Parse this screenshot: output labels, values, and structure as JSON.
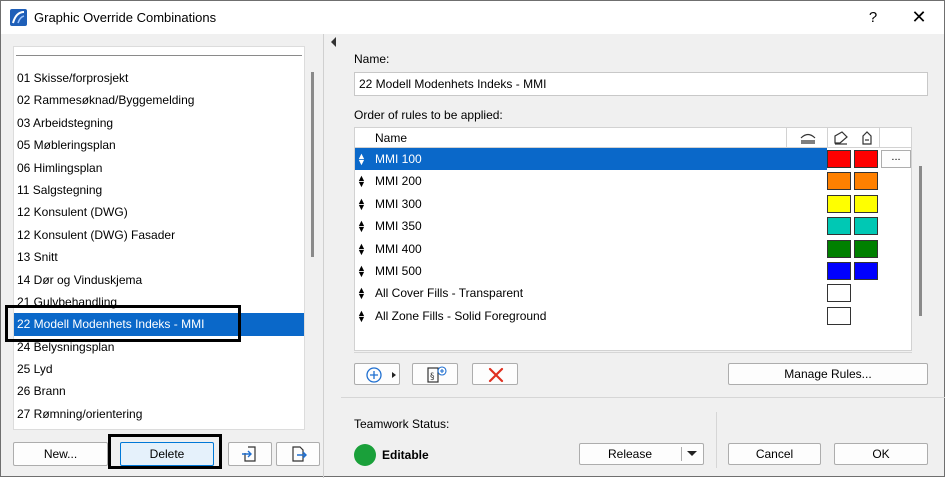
{
  "window": {
    "title": "Graphic Override Combinations",
    "help": "?",
    "close": "✕"
  },
  "combinations": {
    "items": [
      "01 Skisse/forprosjekt",
      "02 Rammesøknad/Byggemelding",
      "03 Arbeidstegning",
      "05 Møbleringsplan",
      "06 Himlingsplan",
      "11 Salgstegning",
      "12 Konsulent (DWG)",
      "12 Konsulent (DWG) Fasader",
      "13 Snitt",
      "14 Dør og Vinduskjema",
      "21 Gulvbehandling",
      "22 Modell Modenhets Indeks - MMI",
      "24 Belysningsplan",
      "25 Lyd",
      "26 Brann",
      "27 Rømning/orientering"
    ],
    "selected_index": 11
  },
  "left_buttons": {
    "new": "New...",
    "delete": "Delete"
  },
  "form": {
    "name_label": "Name:",
    "name_value": "22 Modell Modenhets Indeks - MMI",
    "rules_label": "Order of rules to be applied:"
  },
  "rules": {
    "header_name": "Name",
    "rows": [
      {
        "name": "MMI 100",
        "fill": "#ff0000",
        "line": "#ff0000",
        "selected": true
      },
      {
        "name": "MMI 200",
        "fill": "#ff8000",
        "line": "#ff8000",
        "selected": false
      },
      {
        "name": "MMI 300",
        "fill": "#ffff00",
        "line": "#ffff00",
        "selected": false
      },
      {
        "name": "MMI 350",
        "fill": "#00c8b4",
        "line": "#00c8b4",
        "selected": false
      },
      {
        "name": "MMI 400",
        "fill": "#008000",
        "line": "#008000",
        "selected": false
      },
      {
        "name": "MMI 500",
        "fill": "#0000ff",
        "line": "#0000ff",
        "selected": false
      },
      {
        "name": "All Cover Fills - Transparent",
        "fill": "#ffffff",
        "line": null,
        "selected": false
      },
      {
        "name": "All Zone Fills - Solid Foreground",
        "fill": "#ffffff",
        "line": null,
        "selected": false
      }
    ],
    "more_label": "..."
  },
  "rule_buttons": {
    "manage": "Manage Rules..."
  },
  "teamwork": {
    "label": "Teamwork Status:",
    "status": "Editable",
    "status_color": "#1aa03a",
    "release": "Release"
  },
  "dialog_buttons": {
    "cancel": "Cancel",
    "ok": "OK"
  },
  "colors": {
    "selection": "#0a68c9",
    "remove_icon": "#e03020"
  }
}
